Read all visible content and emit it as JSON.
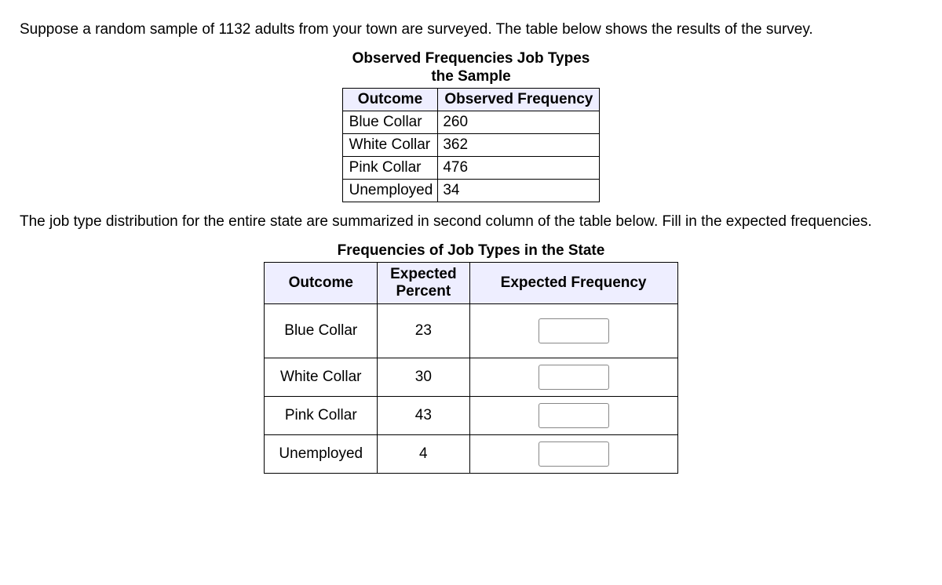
{
  "intro_text": "Suppose a random sample of 1132 adults from your town are surveyed. The table below shows the results of the survey.",
  "table1": {
    "caption_line1": "Observed Frequencies Job Types",
    "caption_line2": "the Sample",
    "headers": {
      "col1": "Outcome",
      "col2": "Observed Frequency"
    },
    "rows": [
      {
        "outcome": "Blue Collar",
        "observed": "260"
      },
      {
        "outcome": "White Collar",
        "observed": "362"
      },
      {
        "outcome": "Pink Collar",
        "observed": "476"
      },
      {
        "outcome": "Unemployed",
        "observed": "34"
      }
    ]
  },
  "mid_text": "The job type distribution for the entire state are summarized in second column of the table below.  Fill in the expected frequencies.",
  "table2": {
    "caption": "Frequencies of Job Types in the State",
    "headers": {
      "col1": "Outcome",
      "col2_line1": "Expected",
      "col2_line2": "Percent",
      "col3": "Expected Frequency"
    },
    "rows": [
      {
        "outcome": "Blue Collar",
        "percent": "23",
        "freq": ""
      },
      {
        "outcome": "White Collar",
        "percent": "30",
        "freq": ""
      },
      {
        "outcome": "Pink Collar",
        "percent": "43",
        "freq": ""
      },
      {
        "outcome": "Unemployed",
        "percent": "4",
        "freq": ""
      }
    ]
  },
  "chart_data": {
    "type": "table",
    "title": "Observed and Expected Frequencies of Job Types",
    "sample_size": 1132,
    "observed": {
      "columns": [
        "Outcome",
        "Observed Frequency"
      ],
      "rows": [
        [
          "Blue Collar",
          260
        ],
        [
          "White Collar",
          362
        ],
        [
          "Pink Collar",
          476
        ],
        [
          "Unemployed",
          34
        ]
      ]
    },
    "expected": {
      "columns": [
        "Outcome",
        "Expected Percent",
        "Expected Frequency"
      ],
      "rows": [
        [
          "Blue Collar",
          23,
          null
        ],
        [
          "White Collar",
          30,
          null
        ],
        [
          "Pink Collar",
          43,
          null
        ],
        [
          "Unemployed",
          4,
          null
        ]
      ]
    }
  }
}
